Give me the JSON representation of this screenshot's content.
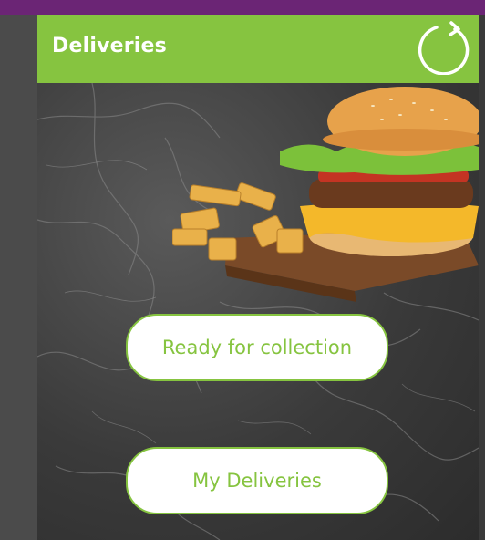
{
  "header": {
    "title": "Deliveries",
    "accent_color": "#86c440",
    "refresh_icon": "refresh-icon"
  },
  "window": {
    "top_bar_color": "#6b2575"
  },
  "actions": {
    "ready_label": "Ready for collection",
    "my_deliveries_label": "My Deliveries"
  },
  "hero": {
    "image_subject": "burger-and-fries"
  }
}
